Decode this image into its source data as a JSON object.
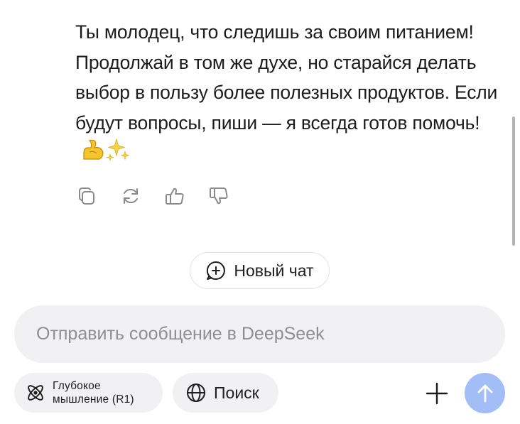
{
  "message": {
    "text": "Ты молодец, что следишь за своим питанием! Продолжай в том же духе, но старайся делать выбор в пользу более полезных продуктов. Если будут вопросы, пиши — я всегда готов помочь!"
  },
  "message_actions": [
    {
      "name": "copy",
      "icon": "copy-icon"
    },
    {
      "name": "regenerate",
      "icon": "refresh-icon"
    },
    {
      "name": "like",
      "icon": "thumbs-up-icon"
    },
    {
      "name": "dislike",
      "icon": "thumbs-down-icon"
    }
  ],
  "new_chat": {
    "label": "Новый чат",
    "icon": "chat-plus-icon"
  },
  "composer": {
    "placeholder": "Отправить сообщение в DeepSeek",
    "value": ""
  },
  "toolbar": {
    "deep_think_label_line1": "Глубокое",
    "deep_think_label_line2": "мышление (R1)",
    "search_label": "Поиск",
    "attach_icon": "plus-icon",
    "send_icon": "arrow-up-icon"
  },
  "colors": {
    "send_button": "#a3bdf6",
    "pill_background": "#f1f1f3",
    "composer_background": "#f1f1f3",
    "icon_gray": "#8a8a8a"
  }
}
